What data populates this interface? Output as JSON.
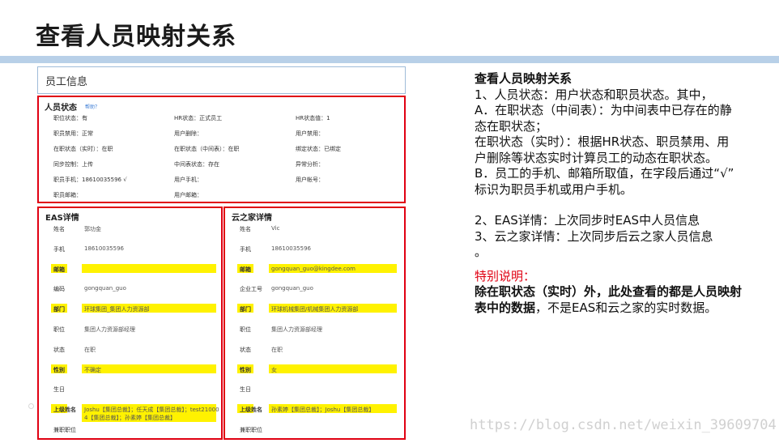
{
  "slide": {
    "title": "查看人员映射关系"
  },
  "panel": {
    "title": "员工信息"
  },
  "status": {
    "title": "人员状态",
    "help": "帮助？",
    "cells": [
      "职位状态：有",
      "HR状态：正式员工",
      "HR状态值：1",
      "职员禁用：正常",
      "用户删除：",
      "用户禁用：",
      "在职状态（实时）：在职",
      "在职状态（中间表）：在职",
      "绑定状态：已绑定",
      "同步控制：上传",
      "中间表状态：存在",
      "异常分析：",
      "职员手机：18610035596 √",
      "用户手机：",
      "用户帐号：",
      "职员邮箱：",
      "用户邮箱：",
      ""
    ]
  },
  "eas": {
    "title": "EAS详情",
    "rows": [
      {
        "label": "姓名",
        "value": "郭功金",
        "hl": false
      },
      {
        "label": "手机",
        "value": "18610035596",
        "hl": false
      },
      {
        "label": "邮箱",
        "value": "",
        "hl": true
      },
      {
        "label": "编码",
        "value": "gongquan_guo",
        "hl": false
      },
      {
        "label": "部门",
        "value": "环球集团_集团人力资源部",
        "hl": true
      },
      {
        "label": "职位",
        "value": "集团人力资源部经理",
        "hl": false
      },
      {
        "label": "状态",
        "value": "在职",
        "hl": false
      },
      {
        "label": "性别",
        "value": "不确定",
        "hl": true
      },
      {
        "label": "生日",
        "value": "",
        "hl": false
      },
      {
        "label": "上级姓名",
        "value": "Joshu【集团总裁】；任天成【集团总裁】；test21000",
        "value2": "4【集团总裁】；孙素婷【集团总裁】",
        "hl": true
      },
      {
        "label": "兼职职位",
        "value": "",
        "hl": false
      }
    ]
  },
  "yzj": {
    "title": "云之家详情",
    "rows": [
      {
        "label": "姓名",
        "value": "Vic",
        "hl": false
      },
      {
        "label": "手机",
        "value": "18610035596",
        "hl": false
      },
      {
        "label": "邮箱",
        "value": "gongquan_guo@kingdee.com",
        "hl": true
      },
      {
        "label": "企业工号",
        "value": "gongquan_guo",
        "hl": false
      },
      {
        "label": "部门",
        "value": "环球机械集团/机械集团人力资源部",
        "hl": true
      },
      {
        "label": "职位",
        "value": "集团人力资源部经理",
        "hl": false
      },
      {
        "label": "状态",
        "value": "在职",
        "hl": false
      },
      {
        "label": "性别",
        "value": "女",
        "hl": true
      },
      {
        "label": "生日",
        "value": "",
        "hl": false
      },
      {
        "label": "上级姓名",
        "value": "孙素婷【集团总裁】；Joshu【集团总裁】",
        "hl": true
      },
      {
        "label": "兼职职位",
        "value": "",
        "hl": false
      }
    ]
  },
  "notes": {
    "title": "查看人员映射关系",
    "l1": "1、人员状态：用户状态和职员状态。其中，",
    "l2": "A．在职状态（中间表）：为中间表中已存在的静",
    "l3": "态在职状态；",
    "l4": "在职状态（实时）：根据HR状态、职员禁用、用",
    "l5": "户删除等状态实时计算员工的动态在职状态。",
    "l6": "B．员工的手机、邮箱所取值，在字段后通过“√”",
    "l7": "标识为职员手机或用户手机。",
    "l8": "2、EAS详情：上次同步时EAS中人员信息",
    "l9": "3、云之家详情：上次同步后云之家人员信息",
    "l10": "。",
    "special_title": "特别说明：",
    "special_bold_a": "除在职状态（实时）外，此处查看的都是人员映射",
    "special_bold_b": "表中的数据",
    "special_rest": "，不是EAS和云之家的实时数据。"
  },
  "watermark": "https://blog.csdn.net/weixin_39609704"
}
